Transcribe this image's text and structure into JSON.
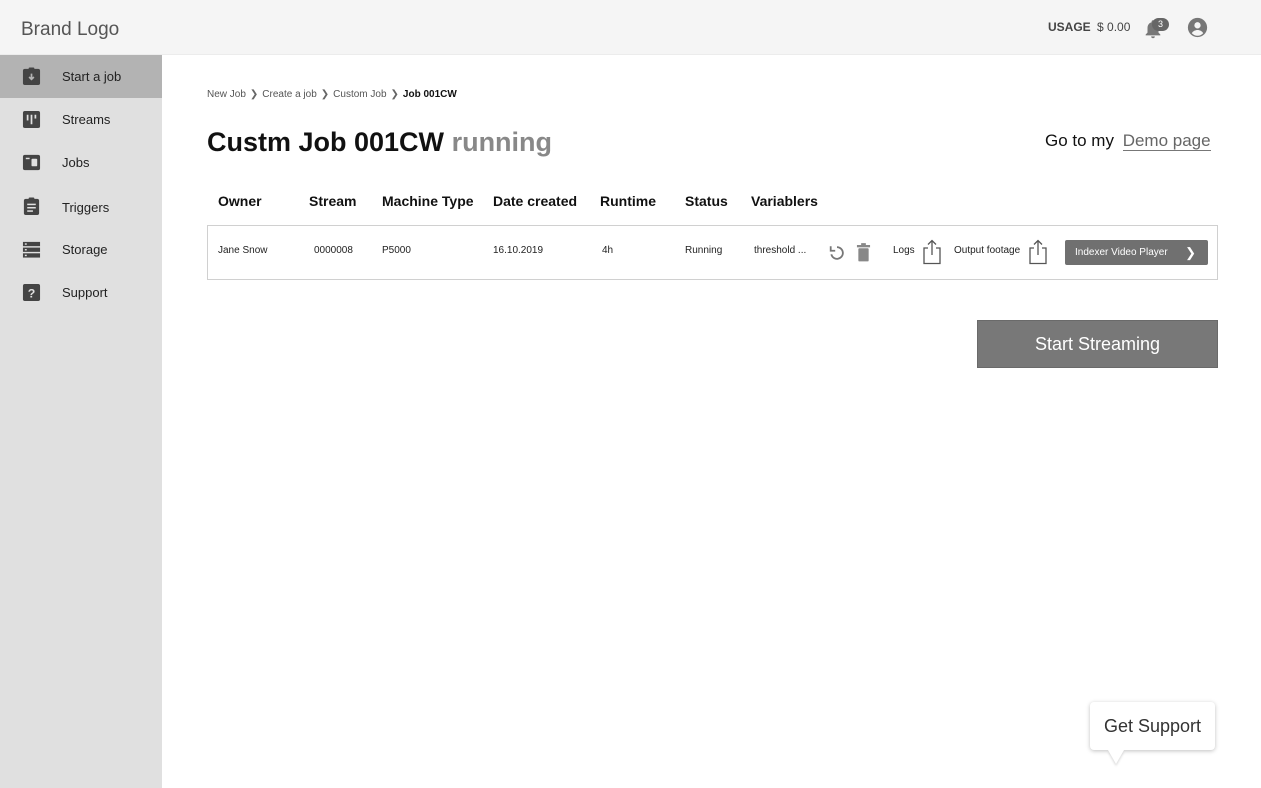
{
  "header": {
    "brand": "Brand Logo",
    "usage_label": "USAGE",
    "usage_value": "$ 0.00",
    "notification_count": "3"
  },
  "sidebar": {
    "items": [
      {
        "label": "Start a job",
        "icon": "clipboard-download-icon",
        "active": true
      },
      {
        "label": "Streams",
        "icon": "streams-icon",
        "active": false
      },
      {
        "label": "Jobs",
        "icon": "jobs-icon",
        "active": false
      },
      {
        "label": "Triggers",
        "icon": "clipboard-list-icon",
        "active": false
      },
      {
        "label": "Storage",
        "icon": "storage-icon",
        "active": false
      },
      {
        "label": "Support",
        "icon": "help-icon",
        "active": false
      }
    ]
  },
  "breadcrumb": [
    "New Job",
    "Create a job",
    "Custom Job",
    "Job 001CW"
  ],
  "page": {
    "title": "Custm Job 001CW",
    "state": "running",
    "demo_prefix": "Go to my",
    "demo_link": "Demo page"
  },
  "table": {
    "headers": [
      "Owner",
      "Stream",
      "Machine Type",
      "Date created",
      "Runtime",
      "Status",
      "Variablers"
    ],
    "row": {
      "owner": "Jane Snow",
      "stream": "0000008",
      "machine_type": "P5000",
      "date_created": "16.10.2019",
      "runtime": "4h",
      "status": "Running",
      "variables": "threshold ...",
      "logs_label": "Logs",
      "output_label": "Output footage",
      "player_button": "Indexer Video Player"
    }
  },
  "actions": {
    "start_streaming": "Start Streaming",
    "get_support": "Get Support"
  },
  "colors": {
    "sidebar_bg": "#e0e0e0",
    "sidebar_active": "#b3b3b3",
    "button_bg": "#787878",
    "header_bg": "#f5f5f5"
  }
}
